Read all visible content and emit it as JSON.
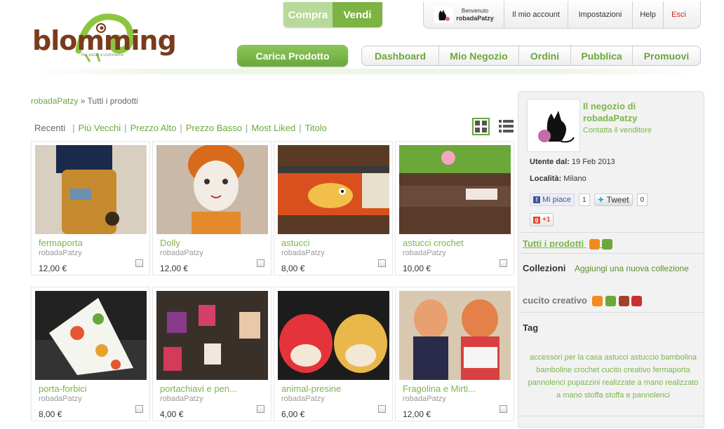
{
  "logo": {
    "text": "blomming",
    "subtitle": "the social e-commerce"
  },
  "topnav": {
    "buy": "Compra",
    "sell": "Vendi"
  },
  "account": {
    "welcome": "Benvenuto",
    "username": "robadaPatzy",
    "my_account": "Il mio account",
    "settings": "Impostazioni",
    "help": "Help",
    "logout": "Esci"
  },
  "upload_button": "Carica Prodotto",
  "mainnav": [
    "Dashboard",
    "Mio Negozio",
    "Ordini",
    "Pubblica",
    "Promuovi"
  ],
  "breadcrumb": {
    "shop": "robadaPatzy",
    "separator": "»",
    "current": "Tutti i prodotti"
  },
  "sort": {
    "active": "Recenti",
    "options": [
      "Più Vecchi",
      "Prezzo Alto",
      "Prezzo Basso",
      "Most Liked",
      "Titolo"
    ]
  },
  "products": [
    {
      "title": "fermaporta",
      "seller": "robadaPatzy",
      "price": "12,00 €"
    },
    {
      "title": "Dolly",
      "seller": "robadaPatzy",
      "price": "12,00 €"
    },
    {
      "title": "astucci",
      "seller": "robadaPatzy",
      "price": "8,00 €"
    },
    {
      "title": "astucci crochet",
      "seller": "robadaPatzy",
      "price": "10,00 €"
    },
    {
      "title": "porta-forbici",
      "seller": "robadaPatzy",
      "price": "8,00 €"
    },
    {
      "title": "portachiavi e pen...",
      "seller": "robadaPatzy",
      "price": "4,00 €"
    },
    {
      "title": "animal-presine",
      "seller": "robadaPatzy",
      "price": "6,00 €"
    },
    {
      "title": "Fragolina e Mirti...",
      "seller": "robadaPatzy",
      "price": "12,00 €"
    }
  ],
  "sidebar": {
    "shop_title_1": "Il negozio di",
    "shop_title_2": "robadaPatzy",
    "contact": "Contatta il venditore",
    "member_since_label": "Utente dal:",
    "member_since": "19 Feb 2013",
    "location_label": "Località:",
    "location": "Milano",
    "like": "Mi piace",
    "like_count": "1",
    "tweet": "Tweet",
    "tweet_count": "0",
    "gplus": "+1",
    "all_products": "Tutti i prodotti",
    "collections_label": "Collezioni",
    "add_collection": "Aggiungi una nuova collezione",
    "collection_name": "cucito creativo",
    "tag_label": "Tag",
    "tags": "accessori per la casa  astucci  astuccio  bambolina  bamboline  crochet  cucito  creativo  fermaporta  pannolenci  pupazzini  realizzate a mano  realizzato a  mano  stoffa  stoffa e pannolenci"
  },
  "colors": {
    "green": "#7ab648",
    "brown": "#7a3b1d",
    "red": "#cc2222"
  }
}
